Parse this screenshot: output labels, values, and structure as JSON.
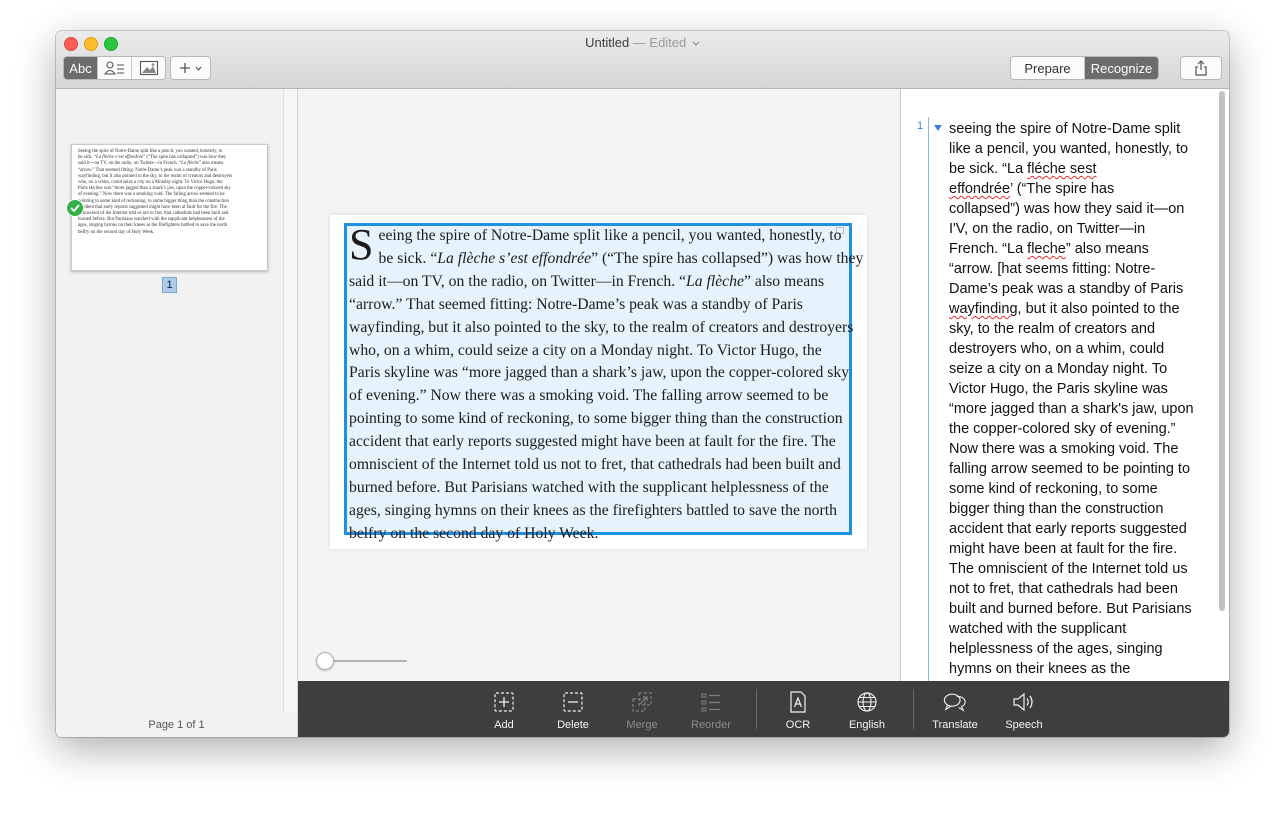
{
  "window": {
    "title": "Untitled",
    "edited": "— Edited"
  },
  "toolbar": {
    "mode_text_label": "Abc",
    "prepare_label": "Prepare",
    "recognize_label": "Recognize",
    "active_tab": "Recognize",
    "icons": [
      "person-text-icon",
      "image-icon",
      "plus-icon",
      "chevron-down-icon",
      "share-icon"
    ]
  },
  "sidebar": {
    "thumbnail_page_number": "1",
    "footer": "Page 1 of 1"
  },
  "document": {
    "dropcap": "S",
    "lines": [
      [
        "eeing the spire of Notre-Dame split like a pencil, you wanted, honestly, to"
      ],
      [
        "be sick. “",
        "La flèche s’est effondrée",
        "” (“The spire has collapsed”) was how they"
      ],
      [
        "said it—on TV, on the radio, on Twitter—in French. “",
        "La flèche",
        "” also means"
      ],
      [
        "“arrow.” That seemed fitting: Notre-Dame’s peak was a standby of Paris"
      ],
      [
        "wayfinding, but it also pointed to the sky, to the realm of creators and destroyers"
      ],
      [
        "who, on a whim, could seize a city on a Monday night. To Victor Hugo, the"
      ],
      [
        "Paris skyline was “more jagged than a shark’s jaw, upon the copper-colored sky"
      ],
      [
        "of evening.” Now there was a smoking void. The falling arrow seemed to be"
      ],
      [
        "pointing to some kind of reckoning, to some bigger thing than the construction"
      ],
      [
        "accident that early reports suggested might have been at fault for the fire. The"
      ],
      [
        "omniscient of the Internet told us not to fret, that cathedrals had been built and"
      ],
      [
        "burned before. But Parisians watched with the supplicant helplessness of the"
      ],
      [
        "ages, singing hymns on their knees as the firefighters battled to save the north"
      ],
      [
        "belfry on the second day of Holy Week."
      ]
    ]
  },
  "result": {
    "block_number": "1",
    "lines": [
      [
        "seeing the spire of Notre-Dame split"
      ],
      [
        "like a pencil, you wanted, honestly, to"
      ],
      [
        "be sick. “La ",
        "fléche sest",
        ""
      ],
      [
        "",
        "effondrée",
        "’ (“The spire has"
      ],
      [
        "collapsed”) was how they said it—on"
      ],
      [
        "I'V, on the radio, on Twitter—in"
      ],
      [
        "French. “La ",
        "fleche",
        "” also means"
      ],
      [
        "“arrow. [hat seems fitting: Notre-"
      ],
      [
        "Dame’s peak was a standby of Paris"
      ],
      [
        "",
        "wayfinding",
        ", but it also pointed to the"
      ],
      [
        "sky, to the realm of creators and"
      ],
      [
        "destroyers who, on a whim, could"
      ],
      [
        "seize a city on a Monday night. To"
      ],
      [
        "Victor Hugo, the Paris skyline was"
      ],
      [
        "“more jagged than a shark's jaw, upon"
      ],
      [
        "the copper-colored sky of evening.”"
      ],
      [
        "Now there was a smoking void. The"
      ],
      [
        "falling arrow seemed to be pointing to"
      ],
      [
        "some kind of reckoning, to some"
      ],
      [
        "bigger thing than the construction"
      ],
      [
        "accident that early reports suggested"
      ],
      [
        "might have been at fault for the fire."
      ],
      [
        "The omniscient of the Internet told us"
      ],
      [
        "not to fret, that cathedrals had been"
      ],
      [
        "built and burned before. But Parisians"
      ],
      [
        "watched with the supplicant"
      ],
      [
        "helplessness of the ages, singing"
      ],
      [
        "hymns on their knees as the"
      ]
    ]
  },
  "bottom_toolbar": {
    "items": [
      {
        "label": "Add",
        "icon": "add-region-icon",
        "enabled": true
      },
      {
        "label": "Delete",
        "icon": "delete-region-icon",
        "enabled": true
      },
      {
        "label": "Merge",
        "icon": "merge-icon",
        "enabled": false
      },
      {
        "label": "Reorder",
        "icon": "reorder-icon",
        "enabled": false
      },
      {
        "label": "OCR",
        "icon": "ocr-icon",
        "enabled": true
      },
      {
        "label": "English",
        "icon": "globe-icon",
        "enabled": true
      },
      {
        "label": "Translate",
        "icon": "translate-icon",
        "enabled": true
      },
      {
        "label": "Speech",
        "icon": "speaker-icon",
        "enabled": true
      }
    ]
  },
  "colors": {
    "selection_border": "#1e90e0",
    "selection_fill": "#e6f3fc",
    "toolbar_dark": "#3e3e3e",
    "accent_blue": "#3a7fd0",
    "success_green": "#33b04a"
  }
}
